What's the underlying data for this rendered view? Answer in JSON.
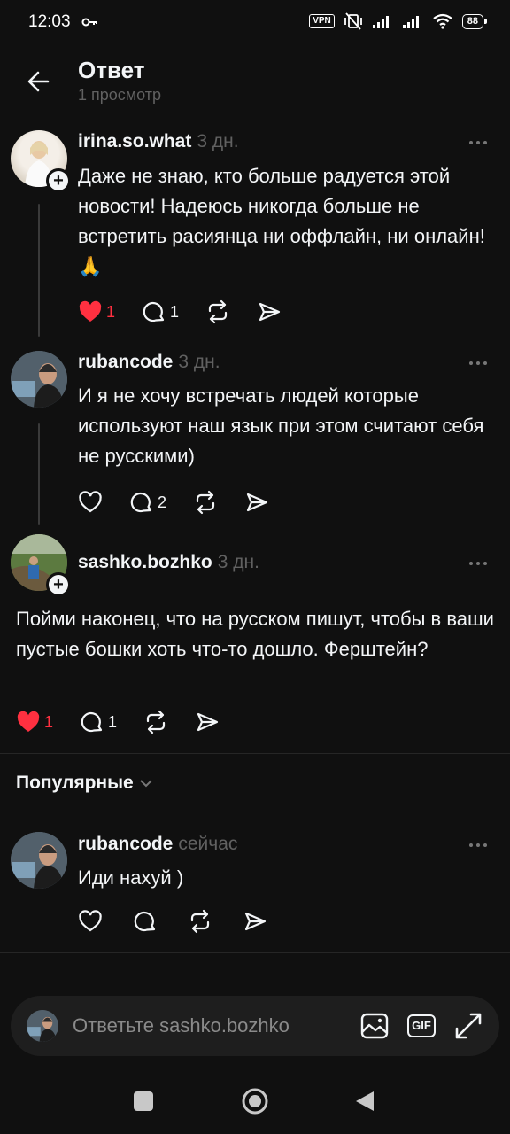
{
  "status_bar": {
    "time": "12:03",
    "vpn": "VPN",
    "battery": "88"
  },
  "header": {
    "title": "Ответ",
    "subtitle": "1 просмотр"
  },
  "posts": [
    {
      "username": "irina.so.what",
      "time": "3 дн.",
      "text": "Даже не знаю, кто больше радуется этой новости! Надеюсь никогда больше не встретить расиянца ни оффлайн, ни онлайн! 🙏",
      "likes": "1",
      "replies": "1",
      "liked": true
    },
    {
      "username": "rubancode",
      "time": "3 дн.",
      "text": "И я не хочу встречать людей которые используют наш язык при этом считают себя не русскими)",
      "likes": "",
      "replies": "2",
      "liked": false
    },
    {
      "username": "sashko.bozhko",
      "time": "3 дн.",
      "text": "Пойми наконец, что на русском пишут, чтобы в ваши пустые бошки хоть что-то дошло. Ферштейн?",
      "likes": "1",
      "replies": "1",
      "liked": true
    }
  ],
  "sort": {
    "label": "Популярные"
  },
  "reply": {
    "username": "rubancode",
    "time": "сейчас",
    "text": "Иди нахуй )"
  },
  "composer": {
    "placeholder": "Ответьте sashko.bozhko",
    "gif_label": "GIF"
  },
  "colors": {
    "background": "#101010",
    "like_red": "#ff3040",
    "muted": "#616161"
  }
}
